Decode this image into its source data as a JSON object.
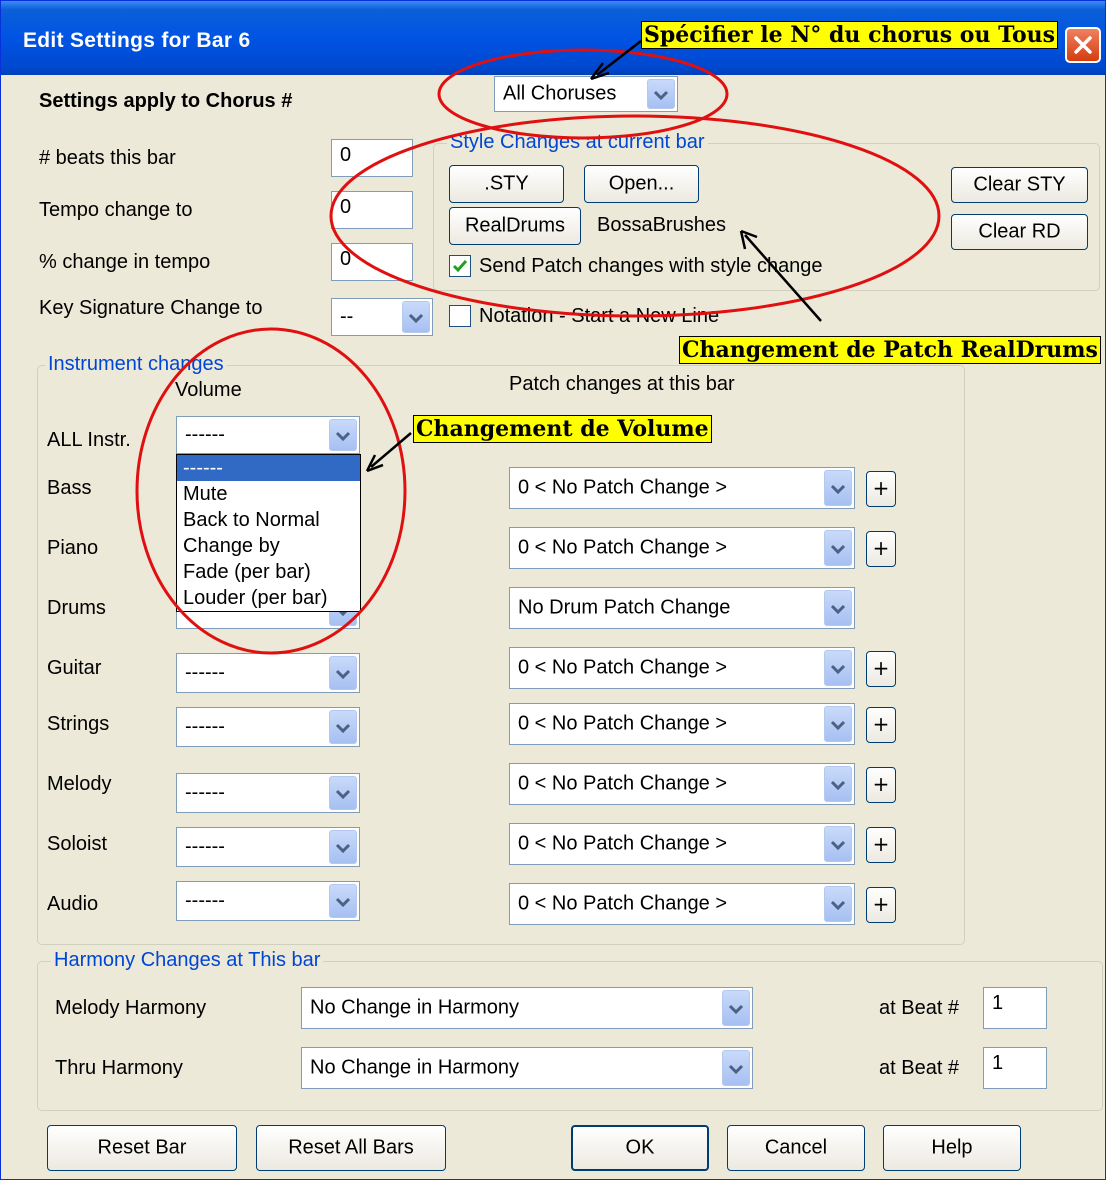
{
  "window": {
    "title": "Edit Settings for Bar 6"
  },
  "chorus": {
    "label": "Settings apply to Chorus #",
    "value": "All Choruses"
  },
  "fields": {
    "beats_label": "# beats this bar",
    "beats_value": "0",
    "tempo_label": "Tempo change to",
    "tempo_value": "0",
    "pct_label": "% change in tempo",
    "pct_value": "0",
    "key_label": "Key Signature Change to",
    "key_value": "--"
  },
  "style_changes": {
    "title": "Style Changes at current bar",
    "sty_button": ".STY",
    "open_button": "Open...",
    "realdrums_button": "RealDrums",
    "realdrums_value": "BossaBrushes",
    "send_patch_label": "Send Patch changes with style change",
    "send_patch_checked": true,
    "clear_sty_button": "Clear STY",
    "clear_rd_button": "Clear RD"
  },
  "notation": {
    "label": "Notation - Start a New Line",
    "checked": false
  },
  "instrument_changes": {
    "title": "Instrument changes",
    "volume_header": "Volume",
    "patch_header": "Patch changes at this bar",
    "all_label": "ALL Instr.",
    "all_volume": "------",
    "rows": [
      {
        "label": "Bass",
        "volume": "------",
        "patch": "0 < No Patch Change >"
      },
      {
        "label": "Piano",
        "volume": "------",
        "patch": "0 < No Patch Change >"
      },
      {
        "label": "Drums",
        "volume": "------",
        "patch": "No Drum Patch Change"
      },
      {
        "label": "Guitar",
        "volume": "------",
        "patch": "0 < No Patch Change >"
      },
      {
        "label": "Strings",
        "volume": "------",
        "patch": "0 < No Patch Change >"
      },
      {
        "label": "Melody",
        "volume": "------",
        "patch": "0 < No Patch Change >"
      },
      {
        "label": "Soloist",
        "volume": "------",
        "patch": "0 < No Patch Change >"
      },
      {
        "label": "Audio",
        "volume": "------",
        "patch": "0 < No Patch Change >"
      }
    ],
    "plus_label": "+"
  },
  "volume_dropdown": {
    "options": [
      "------",
      "Mute",
      "Back to Normal",
      "Change by",
      "Fade (per bar)",
      "Louder (per bar)"
    ],
    "selected": "------"
  },
  "harmony": {
    "title": "Harmony Changes at This bar",
    "melody_label": "Melody Harmony",
    "melody_value": "No Change in Harmony",
    "thru_label": "Thru Harmony",
    "thru_value": "No Change in Harmony",
    "beat_label": "at Beat #",
    "melody_beat": "1",
    "thru_beat": "1"
  },
  "buttons": {
    "reset_bar": "Reset Bar",
    "reset_all": "Reset All Bars",
    "ok": "OK",
    "cancel": "Cancel",
    "help": "Help"
  },
  "annotations": {
    "chorus_note": "Spécifier le N° du chorus ou Tous",
    "realdrums_note": "Changement de Patch RealDrums",
    "volume_note": "Changement de Volume"
  },
  "colors": {
    "title_bar": "#0054e3",
    "dialog_bg": "#ece9d8",
    "group_title": "#0046d5",
    "highlight": "#ffff00",
    "annotation_red": "#e01010",
    "selection": "#316ac5"
  }
}
